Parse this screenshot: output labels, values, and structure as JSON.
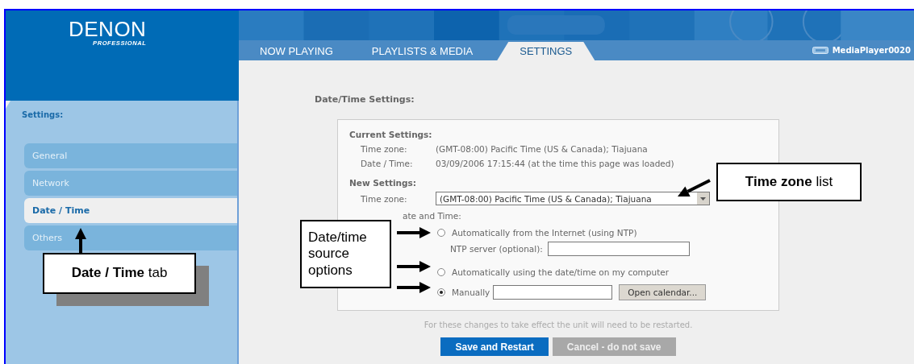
{
  "logo": {
    "brand": "DENON",
    "sub": "PROFESSIONAL"
  },
  "tabs": [
    {
      "label": "NOW PLAYING",
      "selected": false
    },
    {
      "label": "PLAYLISTS & MEDIA",
      "selected": false
    },
    {
      "label": "SETTINGS",
      "selected": true
    }
  ],
  "device": "MediaPlayer0020",
  "sidebar": {
    "title": "Settings:",
    "items": [
      {
        "label": "General",
        "selected": false
      },
      {
        "label": "Network",
        "selected": false
      },
      {
        "label": "Date / Time",
        "selected": true
      },
      {
        "label": "Others",
        "selected": false
      }
    ]
  },
  "page_title": "Date/Time Settings:",
  "current": {
    "heading": "Current Settings:",
    "rows": [
      {
        "label": "Time zone:",
        "value": "(GMT-08:00) Pacific Time (US & Canada); Tiajuana"
      },
      {
        "label": "Date / Time:",
        "value": "03/09/2006 17:15:44 (at the time this page was loaded)"
      }
    ]
  },
  "new": {
    "heading": "New Settings:",
    "time_zone_label": "Time zone:",
    "time_zone_value": "(GMT-08:00) Pacific Time (US & Canada); Tiajuana",
    "set_label": "ate and Time:",
    "options": [
      {
        "kind": "ntp",
        "label": "Automatically from the Internet (using NTP)",
        "selected": false,
        "field_label": "NTP server (optional):"
      },
      {
        "kind": "plain",
        "label": "Automatically using the date/time on my computer",
        "selected": false
      },
      {
        "kind": "manual",
        "label": "Manually",
        "selected": true,
        "button": "Open calendar..."
      }
    ]
  },
  "note": "For these changes to take effect the unit will need to be restarted.",
  "buttons": [
    {
      "label": "Save and Restart",
      "kind": "primary"
    },
    {
      "label": "Cancel - do not save",
      "kind": "disabled"
    }
  ],
  "callouts": [
    {
      "text": "**Date / Time** tab"
    },
    {
      "text": "Date/time source options"
    },
    {
      "text": "**Time zone** list"
    }
  ]
}
